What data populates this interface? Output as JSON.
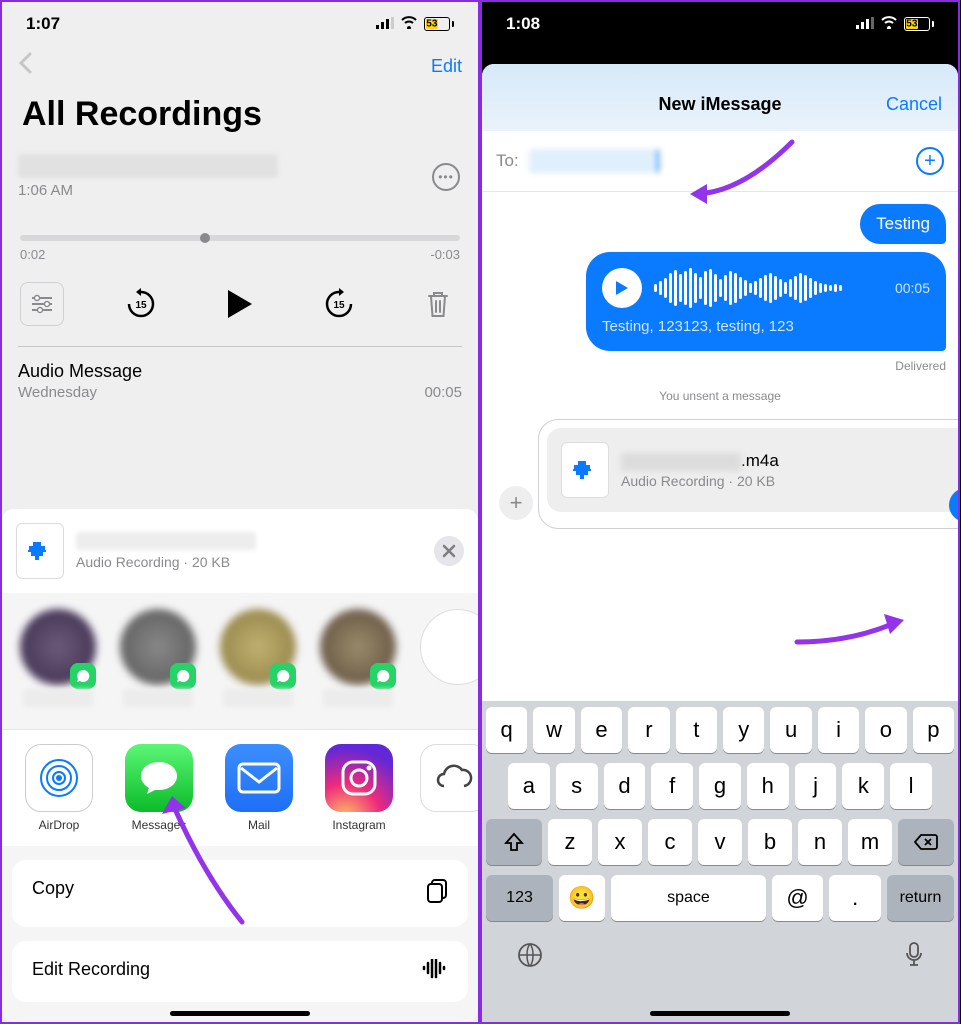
{
  "left": {
    "status": {
      "time": "1:07",
      "battery": "53"
    },
    "nav": {
      "edit": "Edit"
    },
    "title": "All Recordings",
    "current": {
      "subtitle": "1:06 AM",
      "elapsed": "0:02",
      "remaining": "-0:03"
    },
    "item": {
      "title": "Audio Message",
      "day": "Wednesday",
      "dur": "00:05"
    },
    "share": {
      "subtitle": "Audio Recording · 20 KB",
      "apps": {
        "airdrop": "AirDrop",
        "messages": "Messages",
        "mail": "Mail",
        "ig": "Instagram"
      },
      "actions": {
        "copy": "Copy",
        "edit": "Edit Recording"
      }
    }
  },
  "right": {
    "status": {
      "time": "1:08",
      "battery": "53"
    },
    "nav": {
      "title": "New iMessage",
      "cancel": "Cancel"
    },
    "to_label": "To:",
    "msg1": "Testing",
    "audio_dur": "00:05",
    "transcript": "Testing, 123123, testing, 123",
    "delivered": "Delivered",
    "unsent": "You unsent a message",
    "attach": {
      "ext": ".m4a",
      "sub": "Audio Recording · 20 KB"
    },
    "kb": {
      "r1": [
        "q",
        "w",
        "e",
        "r",
        "t",
        "y",
        "u",
        "i",
        "o",
        "p"
      ],
      "r2": [
        "a",
        "s",
        "d",
        "f",
        "g",
        "h",
        "j",
        "k",
        "l"
      ],
      "r3": [
        "z",
        "x",
        "c",
        "v",
        "b",
        "n",
        "m"
      ],
      "num": "123",
      "space": "space",
      "at": "@",
      "dot": ".",
      "ret": "return"
    }
  }
}
